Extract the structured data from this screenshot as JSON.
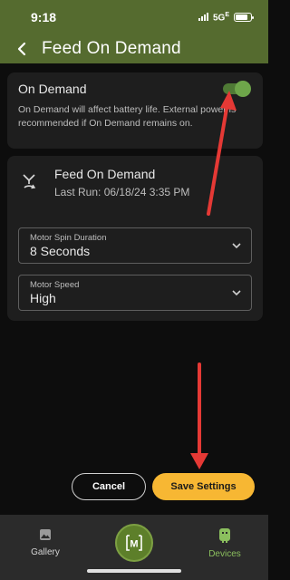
{
  "status_bar": {
    "time": "9:18",
    "network": "5G",
    "network_suffix": "E",
    "battery_level": 0.8
  },
  "header": {
    "title": "Feed On Demand"
  },
  "on_demand": {
    "title": "On Demand",
    "enabled": true,
    "description": "On Demand will affect battery life. External power is recommended if On Demand remains on."
  },
  "feed": {
    "title": "Feed On Demand",
    "last_run": "Last Run: 06/18/24 3:35 PM",
    "motor_spin_duration": {
      "label": "Motor Spin Duration",
      "value": "8 Seconds"
    },
    "motor_speed": {
      "label": "Motor Speed",
      "value": "High"
    }
  },
  "actions": {
    "cancel_label": "Cancel",
    "save_label": "Save Settings"
  },
  "nav": {
    "gallery_label": "Gallery",
    "center_logo": "M",
    "devices_label": "Devices"
  },
  "icons": {
    "back": "chevron-left-icon",
    "feed": "feeder-spin-icon",
    "dropdown": "chevron-down-icon",
    "gallery": "image-icon",
    "devices": "device-icon"
  },
  "colors": {
    "header_bg": "#556b2f",
    "accent_green": "#6ea64a",
    "save_button": "#f7b733",
    "annotation_arrow": "#e53935"
  }
}
